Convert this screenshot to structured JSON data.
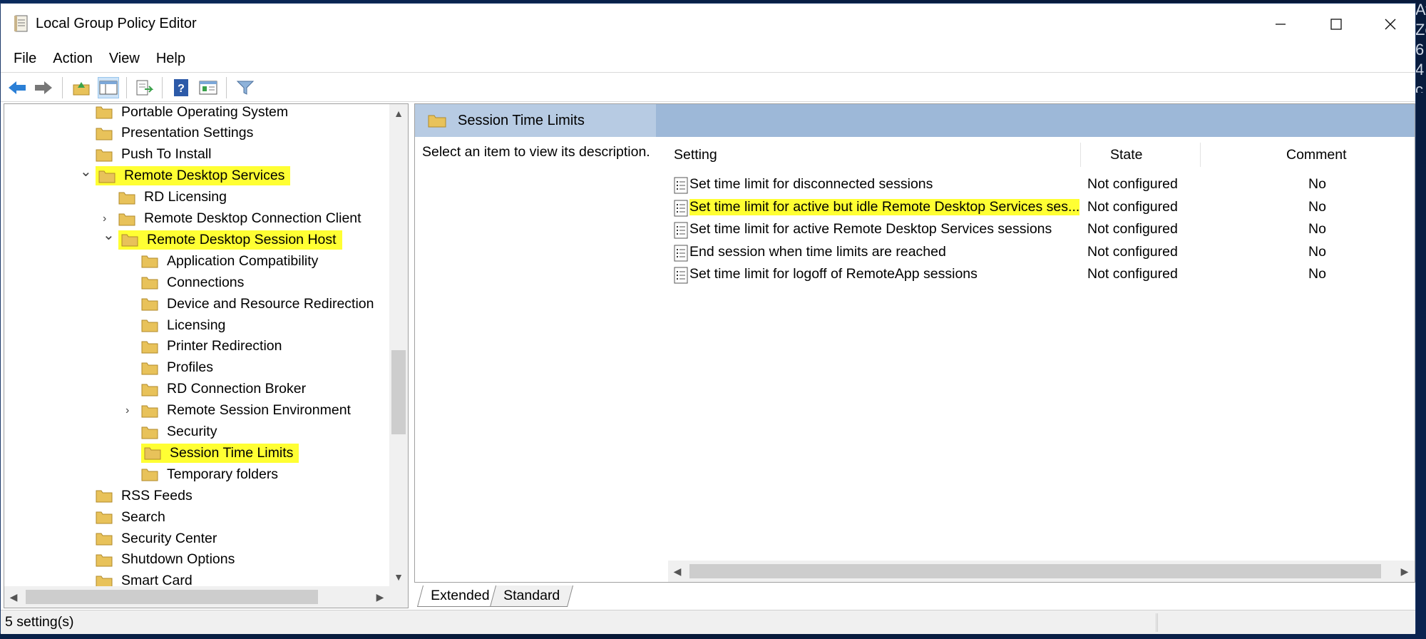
{
  "window": {
    "title": "Local Group Policy Editor"
  },
  "desktop_side_text": [
    "Availability Zone",
    "6",
    "4",
    "c"
  ],
  "menu": [
    "File",
    "Action",
    "View",
    "Help"
  ],
  "toolbar_icons": [
    "back-arrow-icon",
    "forward-arrow-icon",
    "up-folder-icon",
    "show-hide-tree-icon",
    "export-list-icon",
    "help-icon",
    "properties-icon",
    "filter-icon"
  ],
  "tree": [
    {
      "label": "Portable Operating System",
      "level": 0,
      "expander": "",
      "highlight": false
    },
    {
      "label": "Presentation Settings",
      "level": 0,
      "expander": "",
      "highlight": false
    },
    {
      "label": "Push To Install",
      "level": 0,
      "expander": "",
      "highlight": false
    },
    {
      "label": "Remote Desktop Services",
      "level": 0,
      "expander": "v",
      "highlight": true
    },
    {
      "label": "RD Licensing",
      "level": 1,
      "expander": "",
      "highlight": false
    },
    {
      "label": "Remote Desktop Connection Client",
      "level": 1,
      "expander": ">",
      "highlight": false
    },
    {
      "label": "Remote Desktop Session Host",
      "level": 1,
      "expander": "v",
      "highlight": true
    },
    {
      "label": "Application Compatibility",
      "level": 2,
      "expander": "",
      "highlight": false
    },
    {
      "label": "Connections",
      "level": 2,
      "expander": "",
      "highlight": false
    },
    {
      "label": "Device and Resource Redirection",
      "level": 2,
      "expander": "",
      "highlight": false
    },
    {
      "label": "Licensing",
      "level": 2,
      "expander": "",
      "highlight": false
    },
    {
      "label": "Printer Redirection",
      "level": 2,
      "expander": "",
      "highlight": false
    },
    {
      "label": "Profiles",
      "level": 2,
      "expander": "",
      "highlight": false
    },
    {
      "label": "RD Connection Broker",
      "level": 2,
      "expander": "",
      "highlight": false
    },
    {
      "label": "Remote Session Environment",
      "level": 2,
      "expander": ">",
      "highlight": false
    },
    {
      "label": "Security",
      "level": 2,
      "expander": "",
      "highlight": false
    },
    {
      "label": "Session Time Limits",
      "level": 2,
      "expander": "",
      "highlight": true
    },
    {
      "label": "Temporary folders",
      "level": 2,
      "expander": "",
      "highlight": false
    },
    {
      "label": "RSS Feeds",
      "level": 0,
      "expander": "",
      "highlight": false
    },
    {
      "label": "Search",
      "level": 0,
      "expander": "",
      "highlight": false
    },
    {
      "label": "Security Center",
      "level": 0,
      "expander": "",
      "highlight": false
    },
    {
      "label": "Shutdown Options",
      "level": 0,
      "expander": "",
      "highlight": false
    },
    {
      "label": "Smart Card",
      "level": 0,
      "expander": "",
      "highlight": false
    }
  ],
  "right_pane": {
    "header_title": "Session Time Limits",
    "description": "Select an item to view its description.",
    "columns": {
      "setting": "Setting",
      "state": "State",
      "comment": "Comment"
    },
    "rows": [
      {
        "setting": "Set time limit for disconnected sessions",
        "state": "Not configured",
        "comment": "No",
        "highlight": false
      },
      {
        "setting": "Set time limit for active but idle Remote Desktop Services ses...",
        "state": "Not configured",
        "comment": "No",
        "highlight": true
      },
      {
        "setting": "Set time limit for active Remote Desktop Services sessions",
        "state": "Not configured",
        "comment": "No",
        "highlight": false
      },
      {
        "setting": "End session when time limits are reached",
        "state": "Not configured",
        "comment": "No",
        "highlight": false
      },
      {
        "setting": "Set time limit for logoff of RemoteApp sessions",
        "state": "Not configured",
        "comment": "No",
        "highlight": false
      }
    ]
  },
  "tabs": {
    "extended": "Extended",
    "standard": "Standard"
  },
  "status": {
    "text": "5 setting(s)"
  },
  "colors": {
    "highlight": "#ffff33",
    "header_bar": "#9db8d8",
    "folder": "#e8c25a"
  }
}
